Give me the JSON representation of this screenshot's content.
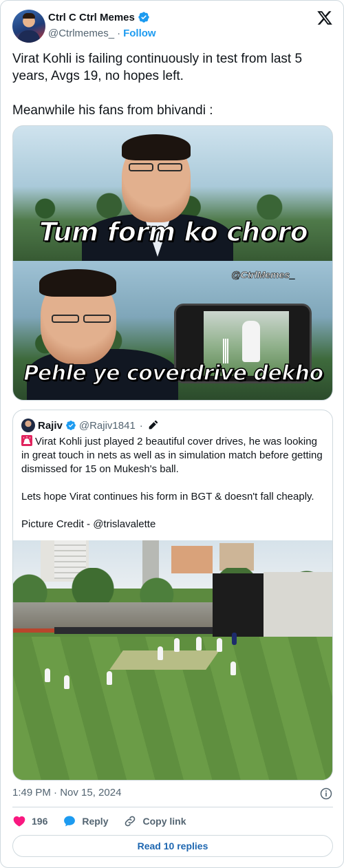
{
  "author": {
    "name": "Ctrl C Ctrl Memes",
    "handle": "@Ctrlmemes_",
    "separator": "·",
    "follow_label": "Follow"
  },
  "tweet": {
    "line1": "Virat Kohli is failing continuously in test from last 5 years, Avgs 19, no hopes left.",
    "line2": "Meanwhile his fans from bhivandi :"
  },
  "meme": {
    "caption_top": "Tum form ko choro",
    "caption_bottom": "Pehle ye coverdrive dekho",
    "watermark": "@CtrlMemes_"
  },
  "quote": {
    "name": "Rajiv",
    "handle": "@Rajiv1841",
    "separator": "·",
    "para1": "Virat Kohli just played 2 beautiful cover drives, he was looking in great touch in nets as well as in simulation match before getting dismissed for 15 on Mukesh's ball.",
    "para2": "Lets hope Virat continues his form in BGT & doesn't fall cheaply.",
    "para3": "Picture Credit - @trislavalette"
  },
  "footer": {
    "timestamp": "1:49 PM · Nov 15, 2024",
    "likes_count": "196",
    "reply_label": "Reply",
    "copy_link_label": "Copy link",
    "read_replies_label": "Read 10 replies"
  },
  "colors": {
    "accent": "#1d9bf0",
    "like": "#f91880",
    "text_secondary": "#536471"
  }
}
